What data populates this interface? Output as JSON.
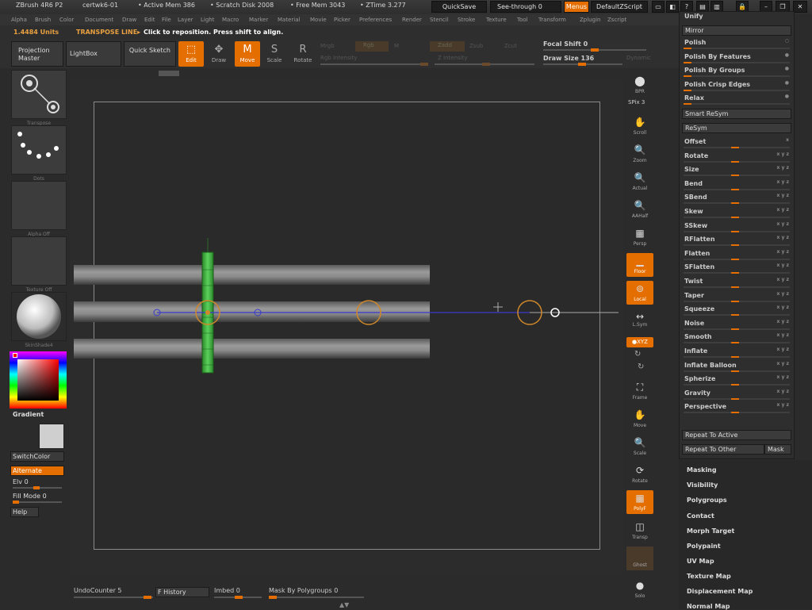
{
  "titlebar": {
    "app": "ZBrush 4R6 P2",
    "doc": "certwk6-01",
    "active_mem": "• Active Mem 386",
    "scratch_disk": "• Scratch Disk 2008",
    "free_mem": "• Free Mem 3043",
    "ztime": "• ZTime 3.277",
    "quicksave": "QuickSave",
    "seethrough": "See-through",
    "seethrough_val": "0",
    "menus": "Menus",
    "default_zscript": "DefaultZScript"
  },
  "menubar": [
    "Alpha",
    "Brush",
    "Color",
    "Document",
    "Draw",
    "Edit",
    "File",
    "Layer",
    "Light",
    "Macro",
    "Marker",
    "Material",
    "Movie",
    "Picker",
    "Preferences",
    "Render",
    "Stencil",
    "Stroke",
    "Texture",
    "Tool",
    "Transform",
    "Zplugin",
    "Zscript"
  ],
  "infobar": {
    "units": "1.4484 Units",
    "mode": "TRANSPOSE LINE▸",
    "hint": "Click to reposition. Press shift to align."
  },
  "shelf": {
    "projection_master": "Projection Master",
    "lightbox": "LightBox",
    "quick_sketch": "Quick Sketch",
    "edit": "Edit",
    "draw": "Draw",
    "move": "Move",
    "scale": "Scale",
    "rotate": "Rotate",
    "mrgb": "Mrgb",
    "rgb": "Rgb",
    "m": "M",
    "zadd": "Zadd",
    "zsub": "Zsub",
    "zcut": "Zcut",
    "rgb_intensity": "Rgb Intensity",
    "z_intensity": "Z Intensity",
    "focal_shift": "Focal Shift",
    "focal_shift_val": "0",
    "draw_size": "Draw Size",
    "draw_size_val": "136",
    "dynamic": "Dynamic"
  },
  "leftshelf": {
    "transpose": "Transpose",
    "dots": "Dots",
    "alpha_off": "Alpha Off",
    "texture_off": "Texture Off",
    "material": "SkinShade4",
    "gradient": "Gradient",
    "switchcolor": "SwitchColor",
    "alternate": "Alternate",
    "elv": "Elv",
    "elv_val": "0",
    "fill_mode": "Fill Mode",
    "fill_mode_val": "0",
    "help": "Help"
  },
  "rightshelf": {
    "bpr": "BPR",
    "spix": "SPix 3",
    "scroll": "Scroll",
    "zoom": "Zoom",
    "actual": "Actual",
    "aahalf": "AAHalf",
    "persp": "Persp",
    "floor": "Floor",
    "local": "Local",
    "lsym": "L.Sym",
    "xyz": "●XYZ",
    "frame": "Frame",
    "move": "Move",
    "scale": "Scale",
    "rotate": "Rotate",
    "polyf": "PolyF",
    "transp": "Transp",
    "ghost": "Ghost",
    "solo": "Solo"
  },
  "deformation": {
    "unify": "Unify",
    "mirror": "Mirror",
    "polish": "Polish",
    "polish_features": "Polish By Features",
    "polish_groups": "Polish By Groups",
    "polish_crisp": "Polish Crisp Edges",
    "relax": "Relax",
    "smart_resym": "Smart ReSym",
    "resym": "ReSym",
    "sliders": [
      {
        "label": "Offset",
        "axes": "x"
      },
      {
        "label": "Rotate",
        "axes": "x y z"
      },
      {
        "label": "Size",
        "axes": "x y z"
      },
      {
        "label": "Bend",
        "axes": "x y z"
      },
      {
        "label": "SBend",
        "axes": "x y z"
      },
      {
        "label": "Skew",
        "axes": "x y z"
      },
      {
        "label": "SSkew",
        "axes": "x y z"
      },
      {
        "label": "RFlatten",
        "axes": "x y z"
      },
      {
        "label": "Flatten",
        "axes": "x y z"
      },
      {
        "label": "SFlatten",
        "axes": "x y z"
      },
      {
        "label": "Twist",
        "axes": "x y z"
      },
      {
        "label": "Taper",
        "axes": "x y z"
      },
      {
        "label": "Squeeze",
        "axes": "x y z"
      },
      {
        "label": "Noise",
        "axes": "x y z"
      },
      {
        "label": "Smooth",
        "axes": "x y z"
      },
      {
        "label": "Inflate",
        "axes": "x y z"
      },
      {
        "label": "Inflate Balloon",
        "axes": "x y z"
      },
      {
        "label": "Spherize",
        "axes": "x y z"
      },
      {
        "label": "Gravity",
        "axes": "x y z"
      },
      {
        "label": "Perspective",
        "axes": "x y z"
      }
    ],
    "repeat_active": "Repeat To Active",
    "repeat_other": "Repeat To Other",
    "mask": "Mask"
  },
  "subpalettes": [
    "Masking",
    "Visibility",
    "Polygroups",
    "Contact",
    "Morph Target",
    "Polypaint",
    "UV Map",
    "Texture Map",
    "Displacement Map",
    "Normal Map"
  ],
  "bottom": {
    "undo_counter": "UndoCounter",
    "undo_val": "5",
    "history": "F History",
    "imbed": "Imbed",
    "imbed_val": "0",
    "mask_polygroups": "Mask By Polygroups",
    "mask_polygroups_val": "0"
  },
  "colors": {
    "accent": "#e46e00",
    "bg": "#2b2b2b",
    "panel": "#2e2e2e"
  }
}
